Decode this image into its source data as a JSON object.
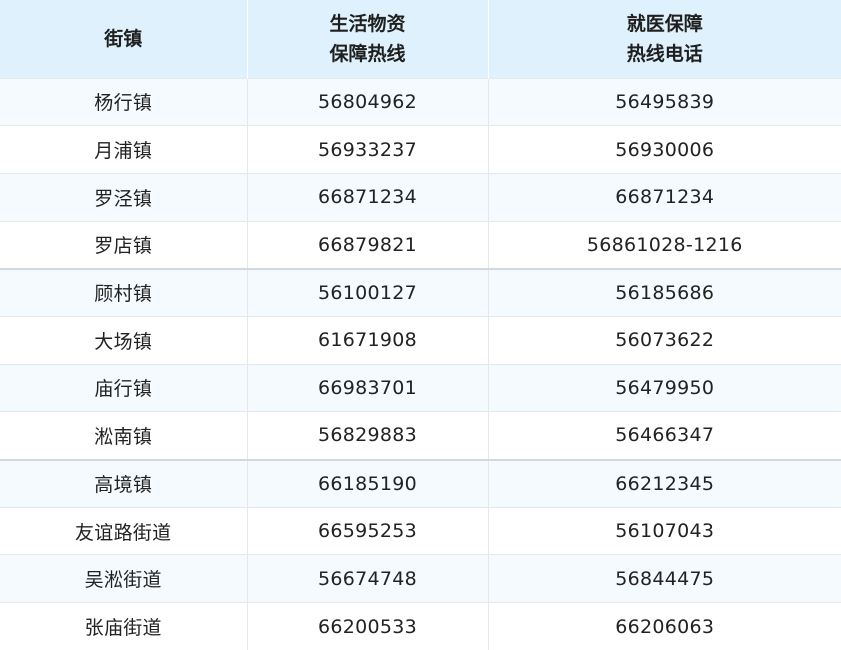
{
  "table": {
    "headers": [
      {
        "lines": [
          "街镇"
        ]
      },
      {
        "lines": [
          "生活物资",
          "保障热线"
        ]
      },
      {
        "lines": [
          "就医保障",
          "热线电话"
        ]
      }
    ],
    "rows": [
      {
        "town": "杨行镇",
        "supply_hotline": "56804962",
        "medical_hotline": "56495839"
      },
      {
        "town": "月浦镇",
        "supply_hotline": "56933237",
        "medical_hotline": "56930006"
      },
      {
        "town": "罗泾镇",
        "supply_hotline": "66871234",
        "medical_hotline": "66871234"
      },
      {
        "town": "罗店镇",
        "supply_hotline": "66879821",
        "medical_hotline": "56861028-1216"
      },
      {
        "town": "顾村镇",
        "supply_hotline": "56100127",
        "medical_hotline": "56185686"
      },
      {
        "town": "大场镇",
        "supply_hotline": "61671908",
        "medical_hotline": "56073622"
      },
      {
        "town": "庙行镇",
        "supply_hotline": "66983701",
        "medical_hotline": "56479950"
      },
      {
        "town": "淞南镇",
        "supply_hotline": "56829883",
        "medical_hotline": "56466347"
      },
      {
        "town": "高境镇",
        "supply_hotline": "66185190",
        "medical_hotline": "66212345"
      },
      {
        "town": "友谊路街道",
        "supply_hotline": "66595253",
        "medical_hotline": "56107043"
      },
      {
        "town": "吴淞街道",
        "supply_hotline": "56674748",
        "medical_hotline": "56844475"
      },
      {
        "town": "张庙街道",
        "supply_hotline": "66200533",
        "medical_hotline": "66206063"
      }
    ]
  },
  "colors": {
    "header_bg": "#dff1fc",
    "row_alt_bg": "#f5fafe",
    "row_bg": "#ffffff",
    "grid": "#e6e9ec",
    "text": "#222222"
  }
}
